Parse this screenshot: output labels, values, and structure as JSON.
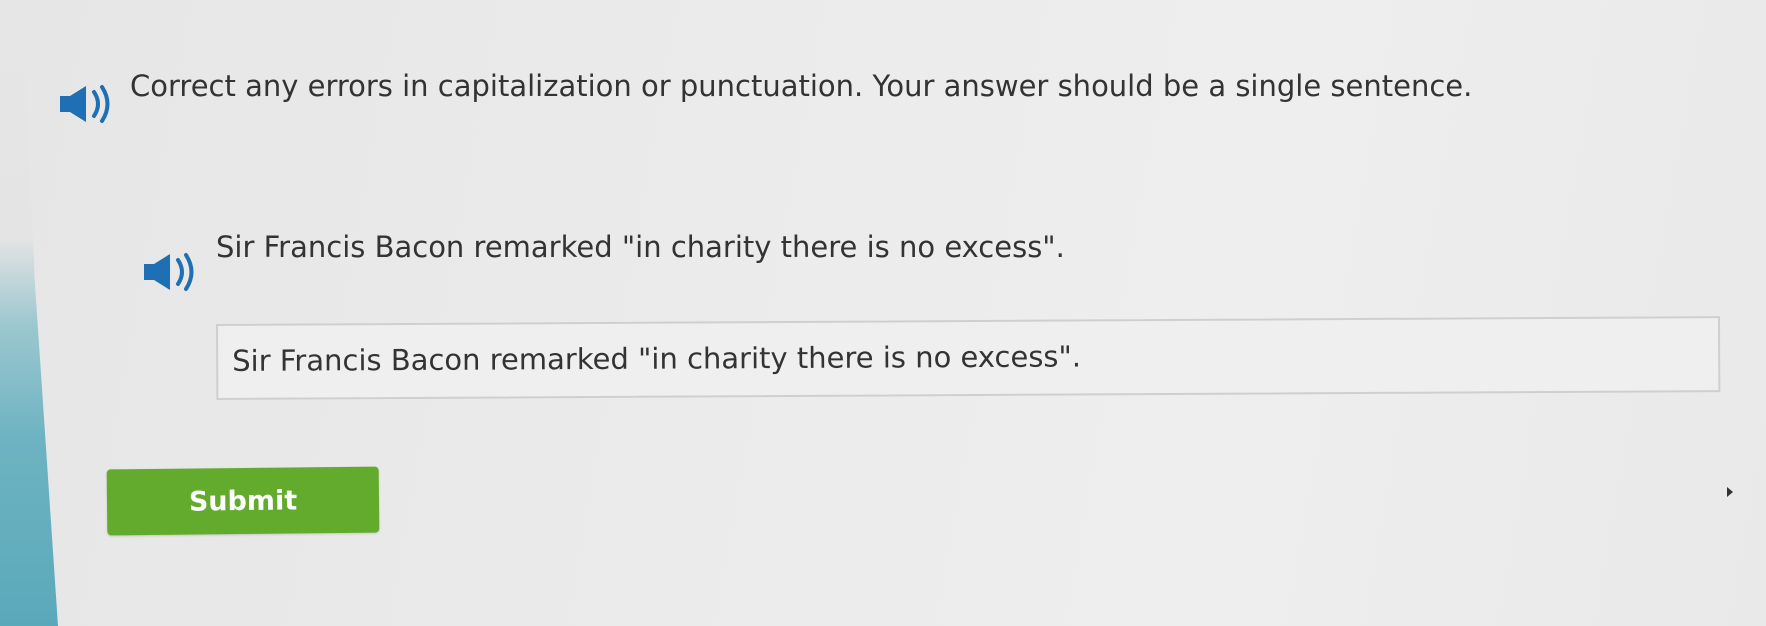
{
  "question": {
    "instruction": "Correct any errors in capitalization or punctuation. Your answer should be a single sentence.",
    "sentence": "Sir Francis Bacon remarked \"in charity there is no excess\"."
  },
  "answer": {
    "value": "Sir Francis Bacon remarked \"in charity there is no excess\"."
  },
  "actions": {
    "submit_label": "Submit"
  },
  "icons": {
    "instruction_audio": "speaker-icon",
    "sentence_audio": "speaker-icon"
  },
  "colors": {
    "submit_green": "#63ab2c",
    "text": "#333333",
    "accent_blue": "#1f6fb5"
  }
}
